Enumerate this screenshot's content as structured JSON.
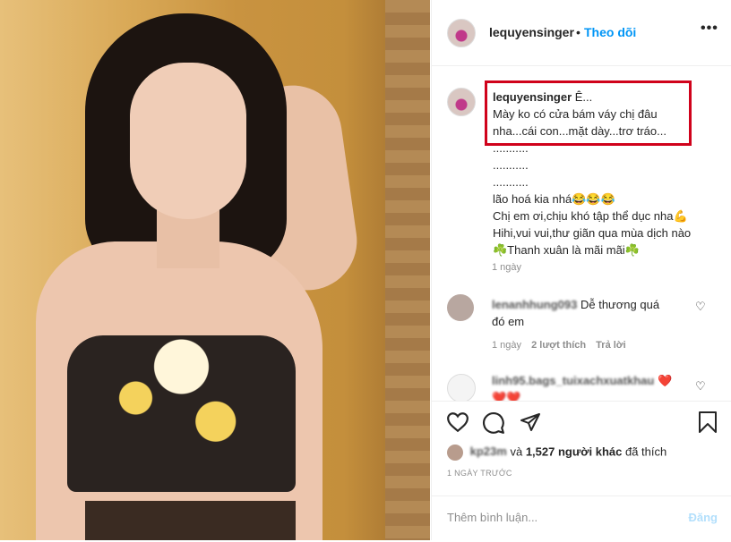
{
  "post": {
    "username": "lequyensinger",
    "dot": "•",
    "follow": "Theo dõi",
    "more": "•••"
  },
  "caption": {
    "username": "lequyensinger",
    "lines": [
      "Ê...",
      "Mày ko có cửa bám váy chị đâu",
      "nha...cái con...mặt dày...trơ tráo...",
      "...........",
      "...........",
      "...........",
      "lão hoá kia nhá😂😂😂",
      "Chị em ơi,chịu khó tập thể dục nha💪",
      "Hihi,vui vui,thư giãn qua mùa dịch nào",
      "☘️Thanh xuân là mãi mãi☘️"
    ],
    "time": "1 ngày"
  },
  "comments": [
    {
      "username": "lenanhhung093",
      "text_line1": "Dễ thương quá",
      "text_line2": "đó em",
      "time": "1 ngày",
      "likes": "2 lượt thích",
      "reply": "Trả lời"
    },
    {
      "username": "linh95.bags_tuixachxuatkhau",
      "text_line1": "❤️",
      "text_line2": "❤️❤️"
    }
  ],
  "likes": {
    "user": "kp23m",
    "text_mid": "và",
    "count": "1,527 người khác",
    "text_end": "đã thích"
  },
  "date": "1 NGÀY TRƯỚC",
  "add_comment": {
    "placeholder": "Thêm bình luận...",
    "post": "Đăng"
  },
  "icons": {
    "like": "heart-outline-icon",
    "comment": "comment-bubble-icon",
    "share": "paper-plane-icon",
    "save": "bookmark-icon"
  }
}
